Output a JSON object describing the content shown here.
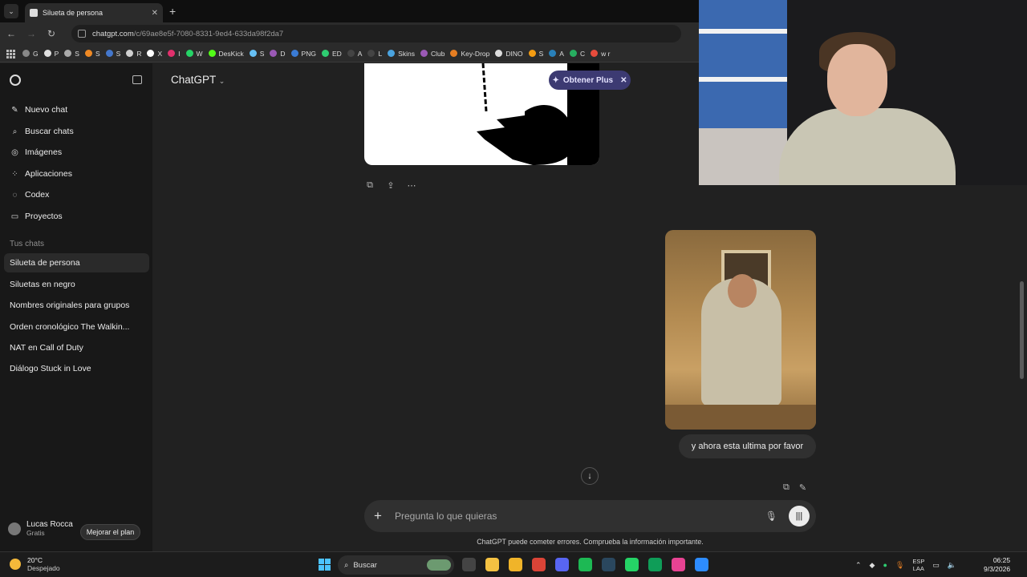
{
  "browser": {
    "tab_title": "Silueta de persona",
    "url_host": "chatgpt.com",
    "url_path": "/c/69ae8e5f-7080-8331-9ed4-633da98f2da7",
    "bookmarks": [
      {
        "label": "G",
        "color": "#888888"
      },
      {
        "label": "P",
        "color": "#e0e0e0"
      },
      {
        "label": "S",
        "color": "#aaaaaa"
      },
      {
        "label": "S",
        "color": "#f08a24"
      },
      {
        "label": "S",
        "color": "#4477cc"
      },
      {
        "label": "R",
        "color": "#d0d0d0"
      },
      {
        "label": "X",
        "color": "#ffffff"
      },
      {
        "label": "I",
        "color": "#e1306c"
      },
      {
        "label": "W",
        "color": "#25d366"
      },
      {
        "label": "DesKick",
        "color": "#53fc18"
      },
      {
        "label": "S",
        "color": "#66c0f4"
      },
      {
        "label": "D",
        "color": "#9b59b6"
      },
      {
        "label": "PNG",
        "color": "#3a7bd5"
      },
      {
        "label": "ED",
        "color": "#2ecc71"
      },
      {
        "label": "A",
        "color": "#444444"
      },
      {
        "label": "L",
        "color": "#444444"
      },
      {
        "label": "Skins",
        "color": "#4aa3df"
      },
      {
        "label": "Club",
        "color": "#9b59b6"
      },
      {
        "label": "Key-Drop",
        "color": "#e67e22"
      },
      {
        "label": "DINO",
        "color": "#dddddd"
      },
      {
        "label": "S",
        "color": "#f39c12"
      },
      {
        "label": "A",
        "color": "#2980b9"
      },
      {
        "label": "C",
        "color": "#27ae60"
      },
      {
        "label": "w r",
        "color": "#e74c3c"
      }
    ]
  },
  "sidebar": {
    "nav": [
      {
        "label": "Nuevo chat",
        "icon": "edit-icon"
      },
      {
        "label": "Buscar chats",
        "icon": "search-icon"
      },
      {
        "label": "Imágenes",
        "icon": "images-icon"
      },
      {
        "label": "Aplicaciones",
        "icon": "apps-icon"
      },
      {
        "label": "Codex",
        "icon": "codex-icon"
      },
      {
        "label": "Proyectos",
        "icon": "folder-icon"
      }
    ],
    "section_title": "Tus chats",
    "chats": [
      "Silueta de persona",
      "Siluetas en negro",
      "Nombres originales para grupos",
      "Orden cronológico The Walkin...",
      "NAT en Call of Duty",
      "Diálogo Stuck in Love"
    ],
    "user": {
      "name": "Lucas Rocca",
      "plan": "Gratis"
    },
    "upgrade_label": "Mejorar el plan"
  },
  "main": {
    "model_label": "ChatGPT",
    "plus_banner": "Obtener Plus",
    "user_message": "y ahora esta ultima por favor",
    "composer_placeholder": "Pregunta lo que quieras",
    "disclaimer": "ChatGPT puede cometer errores. Comprueba la información importante."
  },
  "taskbar": {
    "weather_temp": "20°C",
    "weather_desc": "Despejado",
    "search_label": "Buscar",
    "lang_top": "ESP",
    "lang_bottom": "LAA",
    "time": "06:25",
    "date": "9/3/2026",
    "apps": [
      {
        "name": "file-explorer-icon",
        "color": "#444444"
      },
      {
        "name": "store-icon",
        "color": "#f5c242"
      },
      {
        "name": "folder-icon",
        "color": "#f0b429"
      },
      {
        "name": "chrome-icon",
        "color": "#db4437"
      },
      {
        "name": "discord-icon",
        "color": "#5865f2"
      },
      {
        "name": "spotify-icon",
        "color": "#1db954"
      },
      {
        "name": "steam-icon",
        "color": "#2a475e"
      },
      {
        "name": "whatsapp-icon",
        "color": "#25d366"
      },
      {
        "name": "chrome-profile-icon",
        "color": "#0f9d58"
      },
      {
        "name": "chrome-profile-2-icon",
        "color": "#e84393"
      },
      {
        "name": "blue-app-icon",
        "color": "#2d8cff"
      }
    ]
  }
}
